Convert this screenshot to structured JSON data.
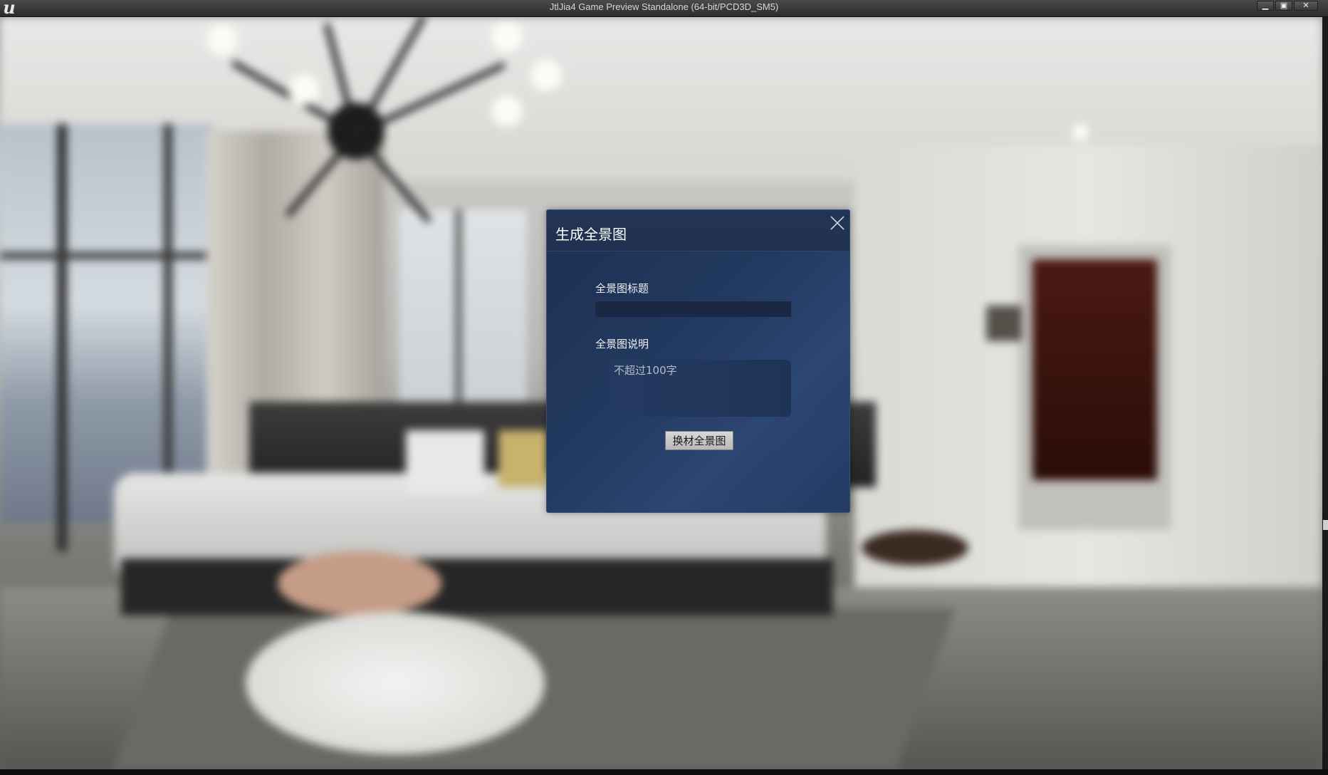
{
  "window": {
    "title": "JtlJia4 Game Preview Standalone (64-bit/PCD3D_SM5)",
    "logo_icon": "unreal-engine-logo",
    "logo_glyph": "u",
    "controls": {
      "minimize_glyph": "▁",
      "maximize_glyph": "▣",
      "close_glyph": "✕"
    }
  },
  "dialog": {
    "title": "生成全景图",
    "close_icon": "close-icon",
    "fields": {
      "title_label": "全景图标题",
      "title_value": "",
      "description_label": "全景图说明",
      "description_placeholder": "不超过100字",
      "description_value": ""
    },
    "action_button_label": "换材全景图"
  },
  "colors": {
    "dialog_background": "#223a60",
    "dialog_header": "#1f3050",
    "button_background": "#c8c8c8",
    "titlebar": "#3a3a3a"
  }
}
